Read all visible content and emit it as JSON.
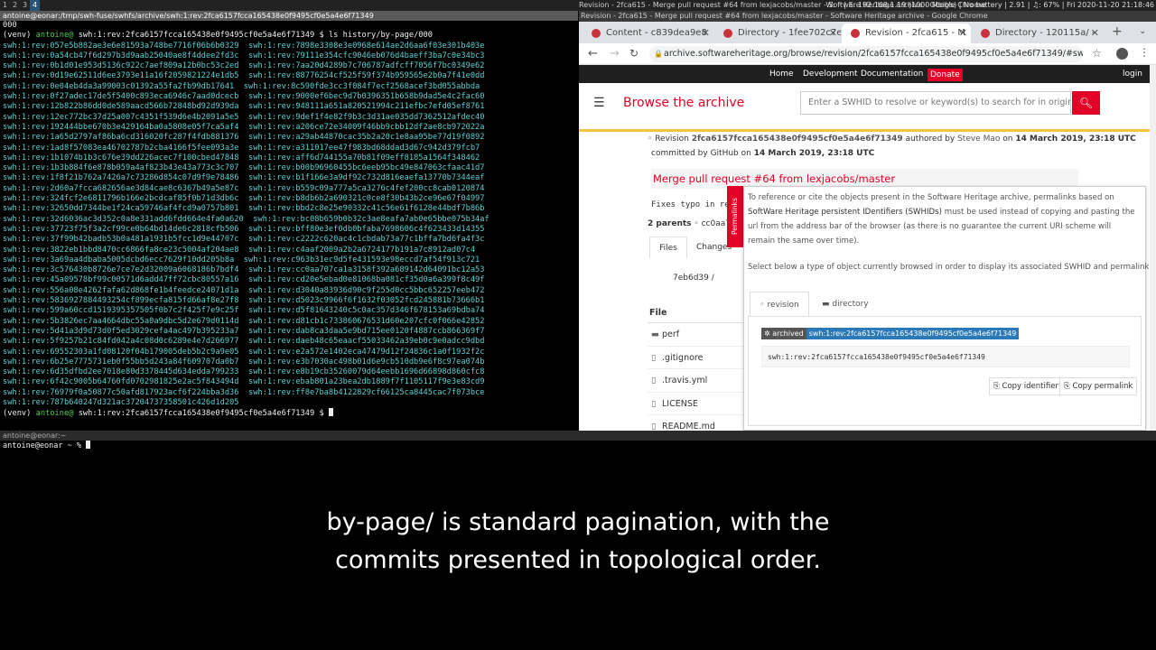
{
  "topbar": {
    "workspaces": [
      "1",
      "2",
      "3",
      "4"
    ],
    "window_title": "Revision - 2fca615 - Merge pull request #64 from lexjacobs/master - Software Heritage archive - Google Chrome",
    "status": "W: ◦ | E: 192.168.1.19 (1000 Mbit/s) | No battery | 2.91 | ♫: 67% | Fri 2020-11-20 21:18:46"
  },
  "terminal": {
    "title": "antoine@eonar:/tmp/swh-fuse/swhfs/archive/swh:1:rev:2fca6157fcca165438e0f9495cf0e5a4e6f71349",
    "first_line": "000",
    "prompt_venv": "(venv)",
    "prompt_user": "antoine@",
    "prompt_cwd": "swh:1:rev:2fca6157fcca165438e0f9495cf0e5a4e6f71349 $",
    "command": "ls history/by-page/000",
    "listing": [
      [
        "swh:1:rev:057e5b882ae3e6e81593a748be7716f06b6b0329",
        "swh:1:rev:7898e3308e3e0968e614ae2d6aa6f03e301b403e"
      ],
      [
        "swh:1:rev:0a54cb47f6d297b3d9aab25040ae8f4ddee2fd3c",
        "swh:1:rev:79111e354cfc9046eb076d4baeff3ba7c0e34bc3"
      ],
      [
        "swh:1:rev:0b1d01e953d5136c922c7aef809a12b0bc53c2ed",
        "swh:1:rev:7aa20d4289b7c706787adfcff7056f7bc0349e62"
      ],
      [
        "swh:1:rev:0d19e62511d6ee3793e11a16f2059821224e1db5",
        "swh:1:rev:88776254cf525f59f374b959565e2b0a7f41e0dd"
      ],
      [
        "swh:1:rev:0e04eb4da3a99003c01392a55fa2fb99db17641",
        "swh:1:rev:8c590fde3cc3f084f7ecf2568acef3bd055abbda"
      ],
      [
        "swh:1:rev:0f27adec17de5f5400c893eca6946c7aad0dcecb",
        "swh:1:rev:9000ef6bec9d7b0396351b658b9dad5e4c2fac60"
      ],
      [
        "swh:1:rev:12b822b86dd0de589aacd566b72848bd92d939da",
        "swh:1:rev:948111a651a820521994c211efbc7efd05ef8761"
      ],
      [
        "swh:1:rev:12ec772bc37d25a007c4351f539d6e4b2091a5e5",
        "swh:1:rev:9def1f4e82f9b3c3d31ae035dd7362512afdec40"
      ],
      [
        "swh:1:rev:192444bbe670b3e429164ba0a5808e05f7ca5af4",
        "swh:1:rev:a206ce72e34009f46bb9cbb12df2ae8cb972022a"
      ],
      [
        "swh:1:rev:1a65d2797af86ba6cd316020fc287f4fdb881376",
        "swh:1:rev:a29ab44870cac35b2a20c1e8aa95be77d19f0892"
      ],
      [
        "swh:1:rev:1ad8f57083ea46702787b2cba4166f5fee093a3e",
        "swh:1:rev:a311017ee47f983bd68ddad3d67c942d379fcb7"
      ],
      [
        "swh:1:rev:1b1074b1b3c676e39dd226acec7f100cbed47848",
        "swh:1:rev:aff6d744155a70b81f09eff8185a1564f348462"
      ],
      [
        "swh:1:rev:1b3b884f6e878b059a4af823b43e43a773c3c707",
        "swh:1:rev:b00b96960455bc6eeb95bc49e847063cfaac41d7"
      ],
      [
        "swh:1:rev:1f8f21b762a7426a7c73286d854c07d9f9e78486",
        "swh:1:rev:b1f166e3a9df92c732d816eaefa13770b7344eaf"
      ],
      [
        "swh:1:rev:2d60a7fcca682656ae3d84cae8c6367b49a5e87c",
        "swh:1:rev:b559c09a777a5ca3276c4fef200cc8cab0120874"
      ],
      [
        "swh:1:rev:324fcf2e6811796b166e2bcdcaf85f0b71d3db6c",
        "swh:1:rev:b8db6b2a690321c0ce8f30b43b2ce96e67f04997"
      ],
      [
        "swh:1:rev:32650dd7344be1f24ca59746af4fcd9a0757b801",
        "swh:1:rev:bbd2c8e25e90332c41c56e61f6128e44bdf7b86b"
      ],
      [
        "swh:1:rev:32d6036ac3d352c0a8e331add6fdd664e4fa0a620",
        "swh:1:rev:bc08b659b0b32c3ae8eafa7ab0e65bbe075b34af"
      ],
      [
        "swh:1:rev:37723f75f3a2cf99ce0b64bd14de6c2818cfb506",
        "swh:1:rev:bff80e3ef0db0bfaba7698606c4f623433d14355"
      ],
      [
        "swh:1:rev:37f99b42badb53b0a481a1931b5fcc1d9e44707c",
        "swh:1:rev:c2222c620ac4c1cbdab73a77c1bffa7bd6fa4f3c"
      ],
      [
        "swh:1:rev:3822eb1bbd8470cc6866fa8ce23c5004af204ae8",
        "swh:1:rev:c4aaf2009a2b2a6724177b191a7c8912ad07c4"
      ],
      [
        "swh:1:rev:3a69aa4dbaba5005dcbd6ecc7629f10dd205b8a",
        "swh:1:rev:c963b31ec9d5fe431593e98eccd7af54f913c721"
      ],
      [
        "swh:1:rev:3c576430b8726e7ce7e2d32009a6068186b7bdf4",
        "swh:1:rev:cc0aa707ca1a3158f392a689142d64091bc12a53"
      ],
      [
        "swh:1:rev:45a09578bf99c00571d6add47ff72cbc80557a16",
        "swh:1:rev:cd20e5ebad0e81068ba081cf35d0a6a399f8c49f"
      ],
      [
        "swh:1:rev:556a08e4262fafa62d868fe1b4feedce24071d1a",
        "swh:1:rev:d3040a83936d90c9f255d0cc5bbc652257eeb472"
      ],
      [
        "swh:1:rev:5836927884493254cf899ecfa815fd66af8e27f8",
        "swh:1:rev:d5023c9966f6f1632f03052fcd245881b73666b1"
      ],
      [
        "swh:1:rev:599a60ccd1519395357505f0b7c2f425f7e9c25f",
        "swh:1:rev:d5f81643240c5c0ac357d346f678153a69bdba74"
      ],
      [
        "swh:1:rev:5b3826ec7aa4664dbc55a0a9dbc5d2e679d0114d",
        "swh:1:rev:d81cb1c733860676531d60e207cfc0f066e42852"
      ],
      [
        "swh:1:rev:5d41a3d9d73d0f5ed3029cefa4ac497b395233a7",
        "swh:1:rev:dab8ca3daa5e9bd715ee0120f4887ccb866369f7"
      ],
      [
        "swh:1:rev:5f9257b21c84fd042a4c08d0c6289e4e7d266977",
        "swh:1:rev:daeb48c65eaacf55033462a39eb0c9e0adcc9dbd"
      ],
      [
        "swh:1:rev:69552303a1fd08120f04b179005deb5b2c9a9e05",
        "swh:1:rev:e2a572e1402eca47479d12f24836c1a0f1932f2c"
      ],
      [
        "swh:1:rev:6b25e7775731eb0f55bb5d243a84f609707da0b7",
        "swh:1:rev:e3b7030ac498b01d6e9cb510db9e6f8c97ea074b"
      ],
      [
        "swh:1:rev:6d35dfbd2ee7018e80d3378445d634edda799233",
        "swh:1:rev:e8b19cb35260079d64eebb1696d66898d860cfc8"
      ],
      [
        "swh:1:rev:6f42c9005b64760fd0702981825e2ac5f843494d",
        "swh:1:rev:ebab801a23bea2db1889f7f1105117f9e3e83cd9"
      ],
      [
        "swh:1:rev:76979f0a50877c50afd817923acf6f224bba3d36",
        "swh:1:rev:ff8e7ba8b4122829cf66125ca8445cac7f073bce"
      ],
      [
        "swh:1:rev:787b640247d321ac37204737358501c426d1d205",
        ""
      ]
    ]
  },
  "browser": {
    "title": "Revision - 2fca615 - Merge pull request #64 from lexjacobs/master - Software Heritage archive - Google Chrome",
    "tabs": [
      {
        "label": "Content - c839dea9e8",
        "active": false
      },
      {
        "label": "Directory - 1fee702c7e",
        "active": false
      },
      {
        "label": "Revision - 2fca615 - M",
        "active": true
      },
      {
        "label": "Directory - 120115a/ -",
        "active": false
      }
    ],
    "url": "archive.softwareheritage.org/browse/revision/2fca6157fcca165438e0f9495cf0e5a4e6f71349/#swh-revision-c...",
    "nav": {
      "home": "Home",
      "development": "Development",
      "documentation": "Documentation",
      "donate": "Donate",
      "login": "login"
    },
    "brand": "Browse the archive",
    "search_placeholder": "Enter a SWHID to resolve or keyword(s) to search for in origin URLs",
    "revision": {
      "prefix": "Revision",
      "id": "2fca6157fcca165438e0f9495cf0e5a4e6f71349",
      "authored_by": "authored by",
      "author": "Steve Mao",
      "on1": "on",
      "author_date": "14 March 2019, 23:18 UTC",
      "committed_by": "committed by",
      "committer": "GitHub",
      "on2": "on",
      "commit_date": "14 March 2019, 23:18 UTC",
      "message_title": "Merge pull request #64 from lexjacobs/master",
      "message_body": "Fixes typo in re",
      "parents": "2 parents",
      "parent1": "cc0aa7",
      "files_tab": "Files",
      "changes_tab": "Changes",
      "dir_path": "7eb6d39 /",
      "file_header": "File",
      "files": [
        {
          "name": "perf",
          "icon": "folder-icon"
        },
        {
          "name": ".gitignore",
          "icon": "file-icon"
        },
        {
          "name": ".travis.yml",
          "icon": "file-icon"
        },
        {
          "name": "LICENSE",
          "icon": "file-icon"
        },
        {
          "name": "README.md",
          "icon": "file-icon"
        }
      ]
    },
    "permalinks": {
      "handle": "Permalinks",
      "info_pre": "To reference or cite the objects present in the Software Heritage archive, permalinks based on",
      "info_link": "SoftWare Heritage persistent IDentifiers (SWHIDs)",
      "info_post": "must be used instead of copying and pasting the url from the address bar of the browser (as there is no guarantee the current URI scheme will remain the same over time).",
      "select_text": "Select below a type of object currently browsed in order to display its associated SWHID and permalink.",
      "tab_revision": "revision",
      "tab_directory": "directory",
      "badge_label": "archived",
      "badge_swhid": "swh:1:rev:2fca6157fcca165438e0f9495cf0e5a4e6f71349",
      "swhid": "swh:1:rev:2fca6157fcca165438e0f9495cf0e5a4e6f71349",
      "copy_identifier": "Copy identifier",
      "copy_permalink": "Copy permalink"
    }
  },
  "terminal2": {
    "title": "antoine@eonar:~",
    "prompt": "antoine@eonar ~ % "
  },
  "subtitle": {
    "line1": "by-page/ is standard pagination, with the",
    "line2": "commits presented in topological order."
  },
  "colors": {
    "terminal_green": "#4ec94e",
    "terminal_cyan": "#5ad0d0",
    "swh_red": "#e20026",
    "swh_yellow": "#f6c43d"
  }
}
